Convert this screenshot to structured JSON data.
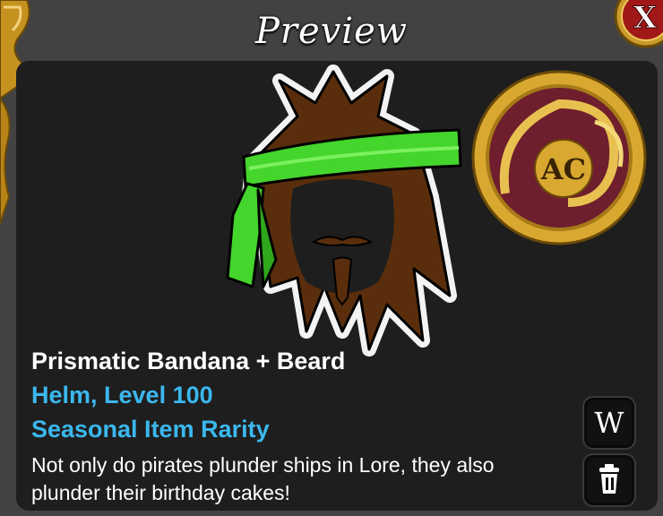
{
  "window": {
    "title": "Preview"
  },
  "close_button": {
    "label": "X"
  },
  "coin": {
    "label": "AC",
    "icon": "ac-coin-icon",
    "colors": {
      "rim": "#d9a830",
      "face": "#6e1e2c"
    }
  },
  "item": {
    "name": "Prismatic Bandana + Beard",
    "type_level": "Helm, Level 100",
    "rarity": "Seasonal Item Rarity",
    "description": "Not only do pirates plunder ships in Lore, they also plunder their birthday cakes!"
  },
  "actions": {
    "wiki_label": "W",
    "wiki_icon": "wiki-icon",
    "delete_icon": "trash-icon"
  },
  "colors": {
    "panel": "#1e1e1e",
    "frame": "#424242",
    "accent_blue": "#3bb8ee",
    "bandana_green": "#44d62c",
    "hair_brown": "#5a2e0c"
  }
}
